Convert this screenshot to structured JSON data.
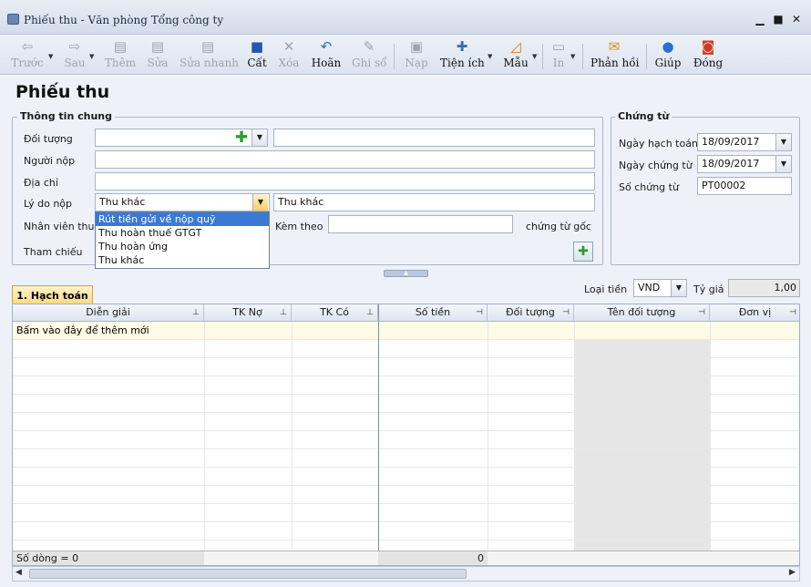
{
  "window": {
    "title": "Phiếu thu - Văn phòng Tổng công ty",
    "minimize": "▁",
    "maximize": "■",
    "close": "✕"
  },
  "toolbar": {
    "prev": "Trước",
    "next": "Sau",
    "add": "Thêm",
    "edit": "Sửa",
    "quick_edit": "Sửa nhanh",
    "save": "Cất",
    "delete": "Xóa",
    "undo": "Hoãn",
    "post": "Ghi sổ",
    "load": "Nạp",
    "utilities": "Tiện ích",
    "template": "Mẫu",
    "print": "In",
    "feedback": "Phản hồi",
    "help": "Giúp",
    "close": "Đóng"
  },
  "heading": "Phiếu thu",
  "general": {
    "legend": "Thông tin chung",
    "subject_label": "Đối tượng",
    "payer_label": "Người nộp",
    "address_label": "Địa chỉ",
    "reason_label": "Lý do nộp",
    "reason_value": "Thu khác",
    "reason_text": "Thu khác",
    "staff_label": "Nhân viên thu",
    "attach_label": "Kèm theo",
    "original_docs_label": "chứng từ gốc",
    "ref_label": "Tham chiếu",
    "reason_options": [
      "Rút tiền gửi về nộp quỹ",
      "Thu hoàn thuế GTGT",
      "Thu hoàn ứng",
      "Thu khác"
    ]
  },
  "voucher": {
    "legend": "Chứng từ",
    "posting_date_label": "Ngày hạch toán",
    "posting_date": "18/09/2017",
    "voucher_date_label": "Ngày chứng từ",
    "voucher_date": "18/09/2017",
    "voucher_no_label": "Số chứng từ",
    "voucher_no": "PT00002"
  },
  "currency": {
    "label": "Loại tiền",
    "value": "VND",
    "rate_label": "Tỷ giá",
    "rate": "1,00"
  },
  "tab": {
    "label": "1. Hạch toán"
  },
  "grid": {
    "columns": [
      "Diễn giải",
      "TK Nợ",
      "TK Có",
      "Số tiền",
      "Đối tượng",
      "Tên đối tượng",
      "Đơn vị"
    ],
    "new_row": "Bấm vào đây để thêm mới",
    "row_count": "Số dòng = 0",
    "total": "0"
  },
  "colors": {
    "tab": "#fbd880",
    "selection": "#3b79d4",
    "new_row": "#fffbe4"
  }
}
